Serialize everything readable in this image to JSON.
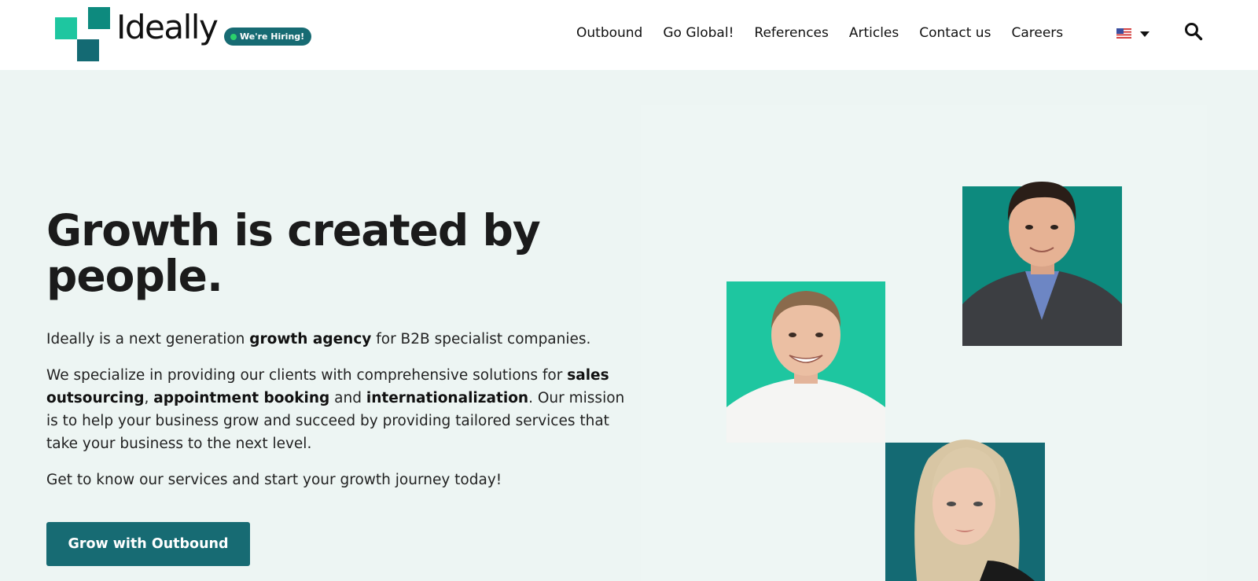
{
  "header": {
    "logo_text": "Ideally",
    "hiring_badge": "We're Hiring!",
    "nav": [
      "Outbound",
      "Go Global!",
      "References",
      "Articles",
      "Contact us",
      "Careers"
    ],
    "language_icon": "us-flag-icon",
    "search_icon": "search-icon"
  },
  "hero": {
    "title_line1": "Growth is created by",
    "title_line2": "people.",
    "p1": {
      "a": "Ideally is a next generation ",
      "b": "growth agency",
      "c": " for B2B specialist companies."
    },
    "p2": {
      "a": "We specialize in providing our clients with comprehensive solutions for ",
      "b": "sales outsourcing",
      "c": ", ",
      "d": "appointment booking",
      "e": " and ",
      "f": "internationalization",
      "g": ". Our mission is to help your business grow and succeed by providing tailored services that take your business to the next level."
    },
    "p3": "Get to know our services and start your growth journey today!",
    "cta_label": "Grow with Outbound"
  },
  "colors": {
    "brand_dark": "#176b73",
    "brand_teal": "#0d8a7e",
    "brand_mint": "#1ec6a0",
    "hero_bg": "#edf5f3"
  }
}
